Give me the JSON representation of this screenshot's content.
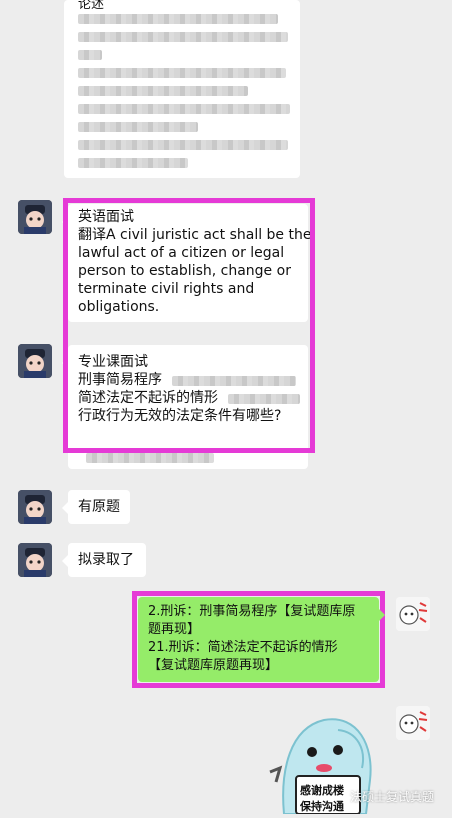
{
  "messages": {
    "top_essay": {
      "label": "论述"
    },
    "english_interview": {
      "title": "英语面试",
      "lines": [
        "翻译A civil juristic act shall be the",
        "lawful act of a citizen or legal",
        "person to establish, change or",
        "terminate civil rights and",
        "obligations."
      ]
    },
    "professional_interview": {
      "title": "专业课面试",
      "line1": "刑事简易程序",
      "line2": "简述法定不起诉的情形",
      "line3": "行政行为无效的法定条件有哪些?"
    },
    "reply_original": {
      "text": "有原题"
    },
    "reply_admitted": {
      "text": "拟录取了"
    },
    "my_message": {
      "lines": [
        "2.刑诉：刑事简易程序【复试题库原",
        "题再现】",
        "21.刑诉：简述法定不起诉的情形",
        "【复试题库原题再现】"
      ]
    },
    "sticker": {
      "line1": "感谢成楼",
      "line2": "保持沟通"
    }
  },
  "watermark": {
    "text": "法硕士复试真题"
  },
  "colors": {
    "background": "#ededed",
    "bubble": "#ffffff",
    "my_bubble": "#95ec69",
    "highlight": "#e53ad6"
  }
}
